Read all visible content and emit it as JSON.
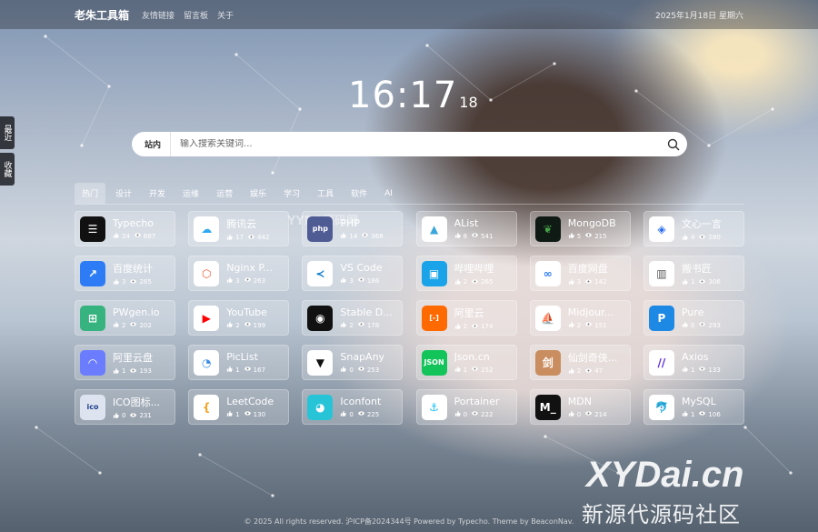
{
  "header": {
    "brand": "老朱工具箱",
    "nav": [
      "友情链接",
      "留言板",
      "关于"
    ],
    "date": "2025年1月18日 星期六"
  },
  "side": {
    "recent": "最近",
    "favorites": "收藏"
  },
  "clock": {
    "hm": "16:17",
    "sec": "18"
  },
  "search": {
    "scope": "站内",
    "placeholder": "输入搜索关键词..."
  },
  "tabs": [
    "热门",
    "设计",
    "开发",
    "运维",
    "运营",
    "娱乐",
    "学习",
    "工具",
    "软件",
    "AI"
  ],
  "active_tab": 0,
  "cards": [
    {
      "name": "Typecho",
      "likes": "24",
      "views": "687",
      "color": "#111111",
      "icon": "typecho-icon",
      "glyph": "☰"
    },
    {
      "name": "腾讯云",
      "likes": "17",
      "views": "442",
      "color": "#ffffff",
      "icon": "tencent-cloud-icon",
      "glyph": "☁"
    },
    {
      "name": "PHP",
      "likes": "14",
      "views": "368",
      "color": "#4f5b93",
      "icon": "php-icon",
      "glyph": "php"
    },
    {
      "name": "AList",
      "likes": "8",
      "views": "541",
      "color": "#ffffff",
      "icon": "alist-icon",
      "glyph": "▲"
    },
    {
      "name": "MongoDB",
      "likes": "5",
      "views": "215",
      "color": "#0f1a14",
      "icon": "mongodb-icon",
      "glyph": "❦"
    },
    {
      "name": "文心一言",
      "likes": "4",
      "views": "280",
      "color": "#ffffff",
      "icon": "wenxin-icon",
      "glyph": "◈"
    },
    {
      "name": "百度统计",
      "likes": "3",
      "views": "265",
      "color": "#2d7cf6",
      "icon": "baidu-tongji-icon",
      "glyph": "↗"
    },
    {
      "name": "Nginx P...",
      "likes": "3",
      "views": "263",
      "color": "#ffffff",
      "icon": "nginx-proxy-icon",
      "glyph": "⬡"
    },
    {
      "name": "VS Code",
      "likes": "3",
      "views": "186",
      "color": "#ffffff",
      "icon": "vscode-icon",
      "glyph": "≺"
    },
    {
      "name": "哔哩哔哩",
      "likes": "2",
      "views": "265",
      "color": "#1aa3e8",
      "icon": "bilibili-icon",
      "glyph": "▣"
    },
    {
      "name": "百度网盘",
      "likes": "3",
      "views": "142",
      "color": "#ffffff",
      "icon": "baidu-pan-icon",
      "glyph": "∞"
    },
    {
      "name": "搬书匠",
      "likes": "1",
      "views": "306",
      "color": "#ffffff",
      "icon": "banshujiang-icon",
      "glyph": "▥"
    },
    {
      "name": "PWgen.io",
      "likes": "2",
      "views": "202",
      "color": "#36b37e",
      "icon": "pwgen-icon",
      "glyph": "⊞"
    },
    {
      "name": "YouTube",
      "likes": "2",
      "views": "199",
      "color": "#ffffff",
      "icon": "youtube-icon",
      "glyph": "▶"
    },
    {
      "name": "Stable D...",
      "likes": "2",
      "views": "178",
      "color": "#111111",
      "icon": "stable-diffusion-icon",
      "glyph": "◉"
    },
    {
      "name": "阿里云",
      "likes": "2",
      "views": "174",
      "color": "#ff6a00",
      "icon": "aliyun-icon",
      "glyph": "[-]"
    },
    {
      "name": "Midjour...",
      "likes": "2",
      "views": "151",
      "color": "#ffffff",
      "icon": "midjourney-icon",
      "glyph": "⛵"
    },
    {
      "name": "Pure",
      "likes": "0",
      "views": "293",
      "color": "#1e88e5",
      "icon": "pure-icon",
      "glyph": "P"
    },
    {
      "name": "阿里云盘",
      "likes": "1",
      "views": "193",
      "color": "#6b7cff",
      "icon": "aliyun-pan-icon",
      "glyph": "◠"
    },
    {
      "name": "PicList",
      "likes": "1",
      "views": "167",
      "color": "#ffffff",
      "icon": "piclist-icon",
      "glyph": "◔"
    },
    {
      "name": "SnapAny",
      "likes": "0",
      "views": "253",
      "color": "#ffffff",
      "icon": "snapany-icon",
      "glyph": "▼"
    },
    {
      "name": "Json.cn",
      "likes": "1",
      "views": "152",
      "color": "#12c45a",
      "icon": "jsoncn-icon",
      "glyph": "JSON"
    },
    {
      "name": "仙剑奇侠...",
      "likes": "2",
      "views": "47",
      "color": "#c98d5f",
      "icon": "xianjian-icon",
      "glyph": "剑"
    },
    {
      "name": "Axios",
      "likes": "1",
      "views": "133",
      "color": "#ffffff",
      "icon": "axios-icon",
      "glyph": "//"
    },
    {
      "name": "ICO图标...",
      "likes": "0",
      "views": "231",
      "color": "#dde4f0",
      "icon": "ico-icon",
      "glyph": "ico"
    },
    {
      "name": "LeetCode",
      "likes": "1",
      "views": "130",
      "color": "#ffffff",
      "icon": "leetcode-icon",
      "glyph": "{"
    },
    {
      "name": "Iconfont",
      "likes": "0",
      "views": "225",
      "color": "#27c4d8",
      "icon": "iconfont-icon",
      "glyph": "◕"
    },
    {
      "name": "Portainer",
      "likes": "0",
      "views": "222",
      "color": "#ffffff",
      "icon": "portainer-icon",
      "glyph": "⚓"
    },
    {
      "name": "MDN",
      "likes": "0",
      "views": "214",
      "color": "#111111",
      "icon": "mdn-icon",
      "glyph": "M_"
    },
    {
      "name": "MySQL",
      "likes": "1",
      "views": "106",
      "color": "#ffffff",
      "icon": "mysql-icon",
      "glyph": "🐬"
    }
  ],
  "glyph_colors": {
    "tencent-cloud-icon": "#2fa9f0",
    "alist-icon": "#3aa6d9",
    "wenxin-icon": "#2a6cf0",
    "nginx-proxy-icon": "#f15833",
    "vscode-icon": "#0a7acc",
    "baidu-pan-icon": "#2d7cf6",
    "banshujiang-icon": "#555555",
    "youtube-icon": "#ff0000",
    "midjourney-icon": "#333333",
    "piclist-icon": "#3a8ee6",
    "snapany-icon": "#111111",
    "axios-icon": "#5a29e4",
    "ico-icon": "#1d3f8c",
    "leetcode-icon": "#f89f1b",
    "portainer-icon": "#13bef9",
    "mysql-icon": "#00758f",
    "mongodb-icon": "#47a248"
  },
  "footer": "© 2025 All rights reserved. 沪ICP备2024344号 Powered by Typecho. Theme by BeaconNav.",
  "watermark": {
    "overlay": "YYDS源码网",
    "line1": "XYDai.cn",
    "line2": "新源代源码社区"
  }
}
